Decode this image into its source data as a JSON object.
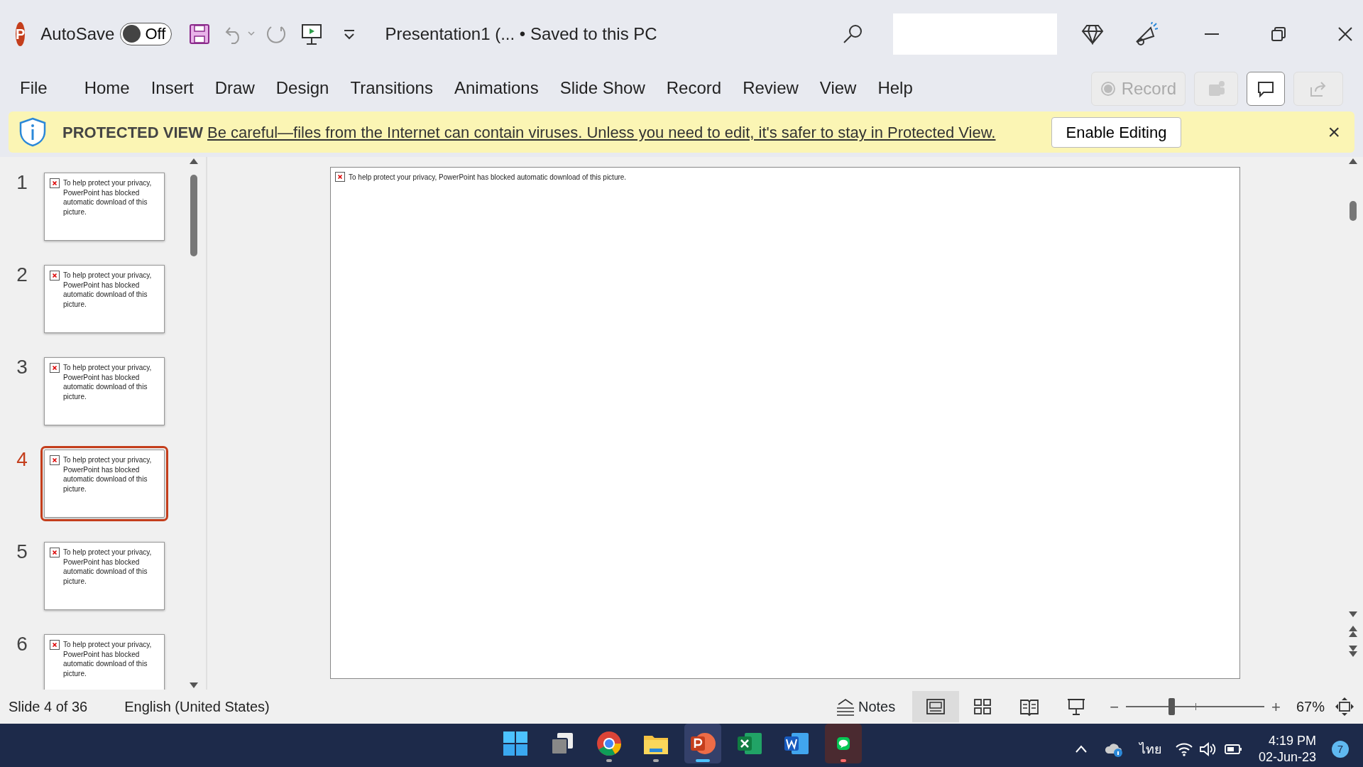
{
  "title_bar": {
    "app_letter": "P",
    "autosave_label": "AutoSave",
    "autosave_toggle": {
      "label": "Off",
      "on": false
    },
    "document_title": "Presentation1 (... • Saved to this PC"
  },
  "ribbon_tabs": [
    {
      "label": "File",
      "selected": false
    },
    {
      "label": "Home",
      "selected": false
    },
    {
      "label": "Insert",
      "selected": false
    },
    {
      "label": "Draw",
      "selected": false
    },
    {
      "label": "Design",
      "selected": false
    },
    {
      "label": "Transitions",
      "selected": false
    },
    {
      "label": "Animations",
      "selected": false
    },
    {
      "label": "Slide Show",
      "selected": false
    },
    {
      "label": "Record",
      "selected": false
    },
    {
      "label": "Review",
      "selected": false
    },
    {
      "label": "View",
      "selected": false
    },
    {
      "label": "Help",
      "selected": false
    }
  ],
  "record_button": {
    "label": "Record",
    "disabled": true
  },
  "protected_view": {
    "label": "PROTECTED VIEW",
    "message": "Be careful—files from the Internet can contain viruses. Unless you need to edit, it's safer to stay in Protected View.",
    "button": "Enable Editing",
    "close": "×"
  },
  "slides": [
    {
      "number": "1",
      "text": "To help protect your privacy, PowerPoint has blocked automatic download of this picture.",
      "selected": false
    },
    {
      "number": "2",
      "text": "To help protect your privacy, PowerPoint has blocked automatic download of this picture.",
      "selected": false
    },
    {
      "number": "3",
      "text": "To help protect your privacy, PowerPoint has blocked automatic download of this picture.",
      "selected": false
    },
    {
      "number": "4",
      "text": "To help protect your privacy, PowerPoint has blocked automatic download of this picture.",
      "selected": true
    },
    {
      "number": "5",
      "text": "To help protect your privacy, PowerPoint has blocked automatic download of this picture.",
      "selected": false
    },
    {
      "number": "6",
      "text": "To help protect your privacy, PowerPoint has blocked automatic download of this picture.",
      "selected": false
    }
  ],
  "main_slide": {
    "text": "To help protect your privacy, PowerPoint has blocked automatic download of this picture."
  },
  "status_bar": {
    "slide_info": "Slide 4 of 36",
    "language": "English (United States)",
    "notes": "Notes",
    "views": [
      {
        "kind": "normal",
        "selected": true
      },
      {
        "kind": "sorter",
        "selected": false
      },
      {
        "kind": "reading",
        "selected": false
      },
      {
        "kind": "slideshow",
        "selected": false
      }
    ],
    "zoom": {
      "minus": "−",
      "plus": "+",
      "level": 0.33,
      "reading": "67%"
    }
  },
  "taskbar": {
    "apps": [
      {
        "kind": "start",
        "running": false,
        "selected": false,
        "attention": false
      },
      {
        "kind": "taskview",
        "running": false,
        "selected": false,
        "attention": false
      },
      {
        "kind": "chrome",
        "running": true,
        "selected": false,
        "attention": false
      },
      {
        "kind": "explorer",
        "running": true,
        "selected": false,
        "attention": false
      },
      {
        "kind": "powerpoint",
        "running": true,
        "selected": true,
        "attention": false
      },
      {
        "kind": "excel",
        "running": false,
        "selected": false,
        "attention": false
      },
      {
        "kind": "word",
        "running": false,
        "selected": false,
        "attention": false
      },
      {
        "kind": "line",
        "running": true,
        "selected": false,
        "attention": true
      }
    ],
    "input_language": "ไทย",
    "time": "4:19 PM",
    "date": "02-Jun-23",
    "notifications": "7"
  }
}
